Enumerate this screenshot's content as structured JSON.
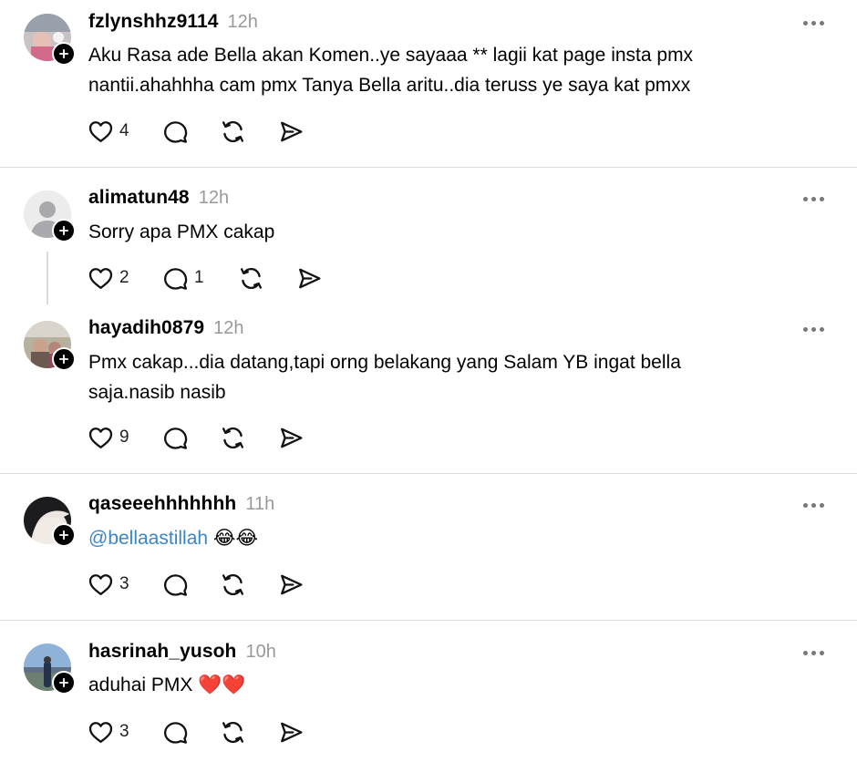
{
  "posts": [
    {
      "username": "fzlynshhz9114",
      "time": "12h",
      "text_lines": [
        "Aku Rasa ade Bella akan Komen..ye sayaaa ** lagii kat page insta pmx",
        "nantii.ahahhha cam pmx Tanya Bella aritu..dia teruss ye saya kat pmxx"
      ],
      "likes": "4",
      "replies": ""
    },
    {
      "username": "alimatun48",
      "time": "12h",
      "text_lines": [
        "Sorry apa PMX cakap"
      ],
      "likes": "2",
      "replies": "1"
    },
    {
      "username": "hayadih0879",
      "time": "12h",
      "text_lines": [
        "Pmx cakap...dia datang,tapi orng belakang yang Salam YB ingat bella",
        "saja.nasib nasib"
      ],
      "likes": "9",
      "replies": ""
    },
    {
      "username": "qaseeehhhhhhh",
      "time": "11h",
      "mention": "@bellaastillah",
      "emoji": "😂😂",
      "likes": "3",
      "replies": ""
    },
    {
      "username": "hasrinah_yusoh",
      "time": "10h",
      "text_lines": [
        "aduhai PMX"
      ],
      "emoji": "❤️❤️",
      "likes": "3",
      "replies": ""
    }
  ],
  "colors": {
    "mention": "#3a86c8",
    "timestamp": "#999999",
    "divider": "#dcdcdc"
  }
}
